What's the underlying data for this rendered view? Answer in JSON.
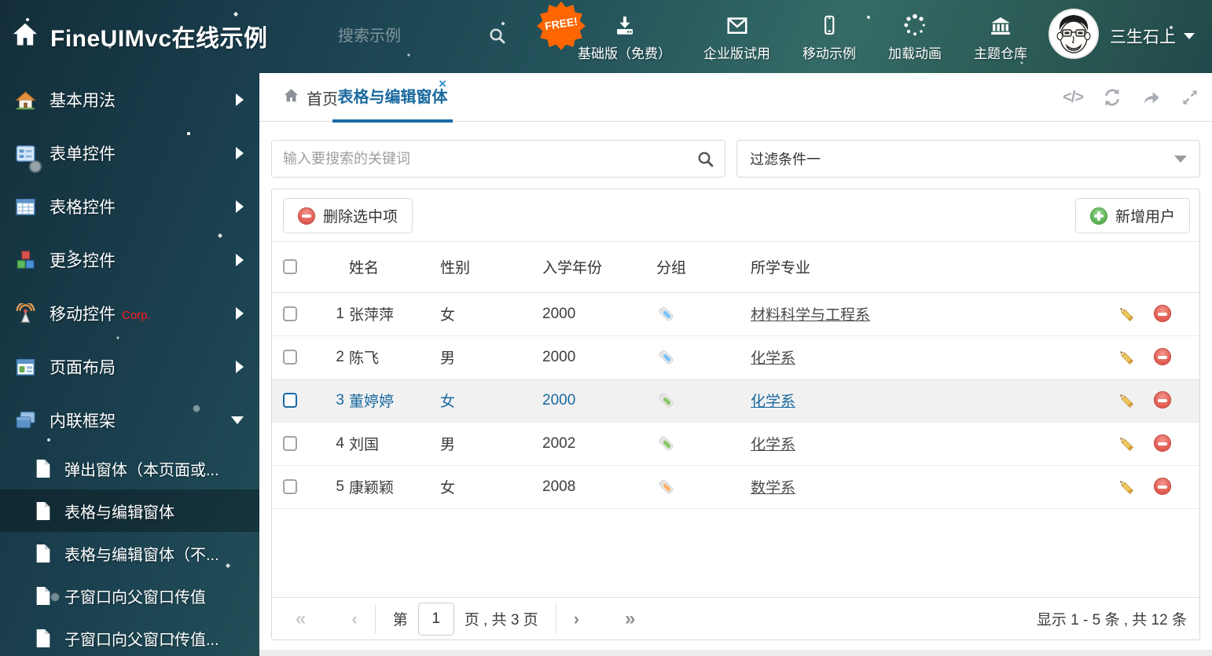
{
  "header": {
    "logo_title": "FineUIMvc在线示例",
    "search_placeholder": "搜索示例",
    "free_badge": "FREE!",
    "nav_items": [
      {
        "label": "基础版（免费）",
        "icon": "download-icon"
      },
      {
        "label": "企业版试用",
        "icon": "envelope-icon"
      },
      {
        "label": "移动示例",
        "icon": "phone-icon"
      },
      {
        "label": "加载动画",
        "icon": "spinner-icon"
      },
      {
        "label": "主题仓库",
        "icon": "bank-icon"
      }
    ],
    "username": "三生石上"
  },
  "sidebar": {
    "items": [
      {
        "label": "基本用法",
        "icon": "home-icon"
      },
      {
        "label": "表单控件",
        "icon": "form-icon"
      },
      {
        "label": "表格控件",
        "icon": "table-icon"
      },
      {
        "label": "更多控件",
        "icon": "cubes-icon"
      },
      {
        "label": "移动控件",
        "badge": "Corp.",
        "icon": "antenna-icon"
      },
      {
        "label": "页面布局",
        "icon": "layout-icon"
      },
      {
        "label": "内联框架",
        "icon": "frames-icon",
        "expanded": true
      }
    ],
    "subitems": [
      {
        "label": "弹出窗体（本页面或..."
      },
      {
        "label": "表格与编辑窗体",
        "active": true
      },
      {
        "label": "表格与编辑窗体（不..."
      },
      {
        "label": "子窗口向父窗口传值"
      },
      {
        "label": "子窗口向父窗口传值..."
      }
    ]
  },
  "tabs": {
    "home_label": "首页",
    "active_label": "表格与编辑窗体",
    "close_glyph": "×",
    "code_glyph": "</>"
  },
  "main": {
    "search_placeholder": "输入要搜索的关键词",
    "filter_value": "过滤条件一",
    "delete_button": "删除选中项",
    "add_button": "新增用户",
    "table": {
      "columns": [
        "姓名",
        "性别",
        "入学年份",
        "分组",
        "所学专业"
      ],
      "rows": [
        {
          "num": "1",
          "name": "张萍萍",
          "gender": "女",
          "year": "2000",
          "tag_color": "#7cc3f7",
          "major": "材料科学与工程系",
          "selected": false
        },
        {
          "num": "2",
          "name": "陈飞",
          "gender": "男",
          "year": "2000",
          "tag_color": "#7cc3f7",
          "major": "化学系",
          "selected": false
        },
        {
          "num": "3",
          "name": "董婷婷",
          "gender": "女",
          "year": "2000",
          "tag_color": "#8bc767",
          "major": "化学系",
          "selected": true
        },
        {
          "num": "4",
          "name": "刘国",
          "gender": "男",
          "year": "2002",
          "tag_color": "#8bc767",
          "major": "化学系",
          "selected": false
        },
        {
          "num": "5",
          "name": "康颖颖",
          "gender": "女",
          "year": "2008",
          "tag_color": "#f7b06a",
          "major": "数学系",
          "selected": false
        }
      ]
    },
    "pagination": {
      "prefix": "第",
      "current_page": "1",
      "suffix": "页 , 共 3 页",
      "first_glyph": "«",
      "prev_glyph": "‹",
      "next_glyph": "›",
      "last_glyph": "»",
      "summary": "显示 1 - 5 条 , 共 12 条"
    }
  },
  "colors": {
    "accent_blue": "#1a6aa5",
    "danger_red": "#dd5449",
    "success_green": "#5cb85c",
    "badge_orange": "#ff6600",
    "corp_red": "#ff1a1a"
  }
}
